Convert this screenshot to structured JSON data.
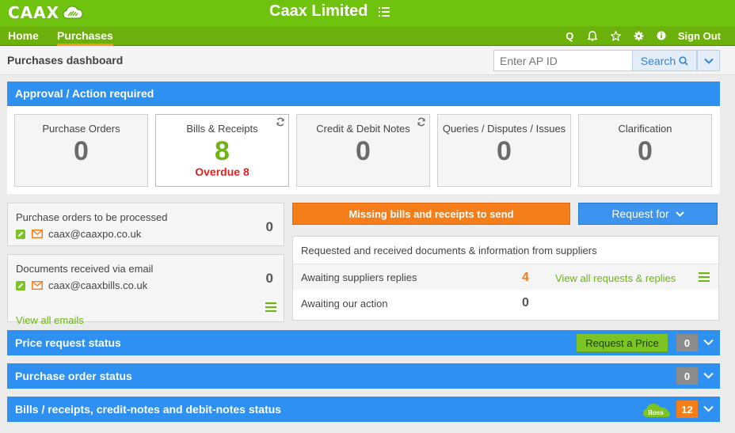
{
  "app": {
    "logo_text": "CAAX",
    "company": "Caax Limited",
    "colors": {
      "brand_green": "#6fc20e",
      "primary_blue": "#2e90f0",
      "orange": "#f57d1a",
      "alert_red": "#e02020"
    }
  },
  "nav": {
    "home": "Home",
    "purchases": "Purchases",
    "icons": [
      "search-q-icon",
      "bell-icon",
      "star-icon",
      "gear-icon",
      "info-icon"
    ],
    "q_label": "Q",
    "sign_out": "Sign Out"
  },
  "subheader": {
    "title": "Purchases dashboard",
    "search_placeholder": "Enter AP ID",
    "search_label": "Search"
  },
  "approval": {
    "header": "Approval / Action required",
    "cards": [
      {
        "label": "Purchase Orders",
        "value": "0"
      },
      {
        "label": "Bills & Receipts",
        "value": "8",
        "overdue": "Overdue 8"
      },
      {
        "label": "Credit & Debit Notes",
        "value": "0"
      },
      {
        "label": "Queries / Disputes / Issues",
        "value": "0"
      },
      {
        "label": "Clarification",
        "value": "0"
      }
    ]
  },
  "po_box": {
    "title": "Purchase orders to be processed",
    "email": "caax@caaxpo.co.uk",
    "count": "0"
  },
  "docs_box": {
    "title": "Documents received via email",
    "email": "caax@caaxbills.co.uk",
    "count": "0",
    "link": "View all emails"
  },
  "actions": {
    "missing": "Missing bills and receipts to send",
    "request_for": "Request for"
  },
  "requests": {
    "title": "Requested and received documents & information from suppliers",
    "awaiting_suppliers": "Awaiting suppliers replies",
    "awaiting_suppliers_count": "4",
    "view_all": "View all requests & replies",
    "awaiting_ours": "Awaiting our action",
    "awaiting_ours_count": "0"
  },
  "status": {
    "price": {
      "title": "Price request status",
      "button": "Request a Price",
      "count": "0"
    },
    "po": {
      "title": "Purchase order status",
      "count": "0"
    },
    "bills": {
      "title": "Bills / receipts, credit-notes and debit-notes status",
      "boss_label": "Boss",
      "count": "12"
    }
  }
}
